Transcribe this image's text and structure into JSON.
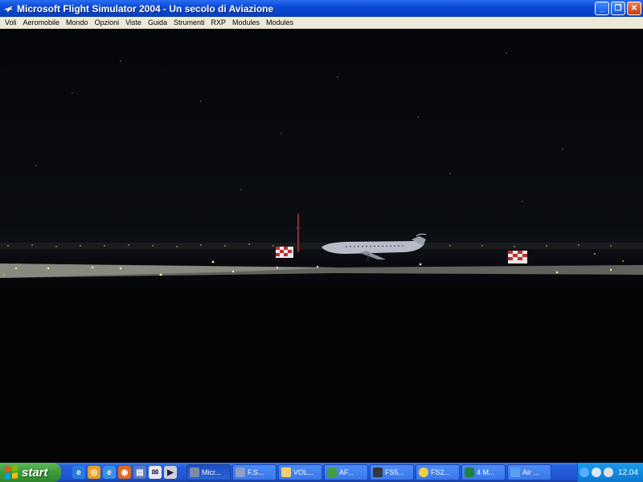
{
  "window": {
    "title": "Microsoft Flight Simulator 2004 - Un secolo di Aviazione",
    "buttons": {
      "minimize": "_",
      "restore": "❐",
      "close": "✕"
    }
  },
  "menu": {
    "items": [
      "Voli",
      "Aeromobile",
      "Mondo",
      "Opzioni",
      "Viste",
      "Guida",
      "Strumenti",
      "RXP",
      "Modules",
      "Modules"
    ]
  },
  "scene": {
    "description_icon": "night-runway-scene",
    "colors": {
      "sky": "#06080b",
      "runway": "#8a8a80",
      "lights": "#f5d89a"
    }
  },
  "taskbar": {
    "start_label": "start",
    "quicklaunch": [
      "ie-icon",
      "winamp-icon",
      "ie-icon",
      "firefox-icon",
      "outlook-icon",
      "email-icon",
      "media-icon"
    ],
    "tasks": [
      {
        "label": "Micr...",
        "active": true,
        "icon": "fs-icon",
        "color": "#7a8aa8"
      },
      {
        "label": "F.S...",
        "active": false,
        "icon": "plane-icon",
        "color": "#8aa0c8"
      },
      {
        "label": "VOL...",
        "active": false,
        "icon": "folder-icon",
        "color": "#f0d070"
      },
      {
        "label": "AF...",
        "active": false,
        "icon": "app-icon",
        "color": "#40a040"
      },
      {
        "label": "FS5...",
        "active": false,
        "icon": "window-icon",
        "color": "#303840"
      },
      {
        "label": "FS2...",
        "active": false,
        "icon": "coin-icon",
        "color": "#f0d040"
      },
      {
        "label": "4 M...",
        "active": false,
        "icon": "excel-icon",
        "color": "#208040"
      },
      {
        "label": "Air ...",
        "active": false,
        "icon": "ie-icon",
        "color": "#5aa0f0"
      }
    ],
    "clock": "12.04"
  }
}
